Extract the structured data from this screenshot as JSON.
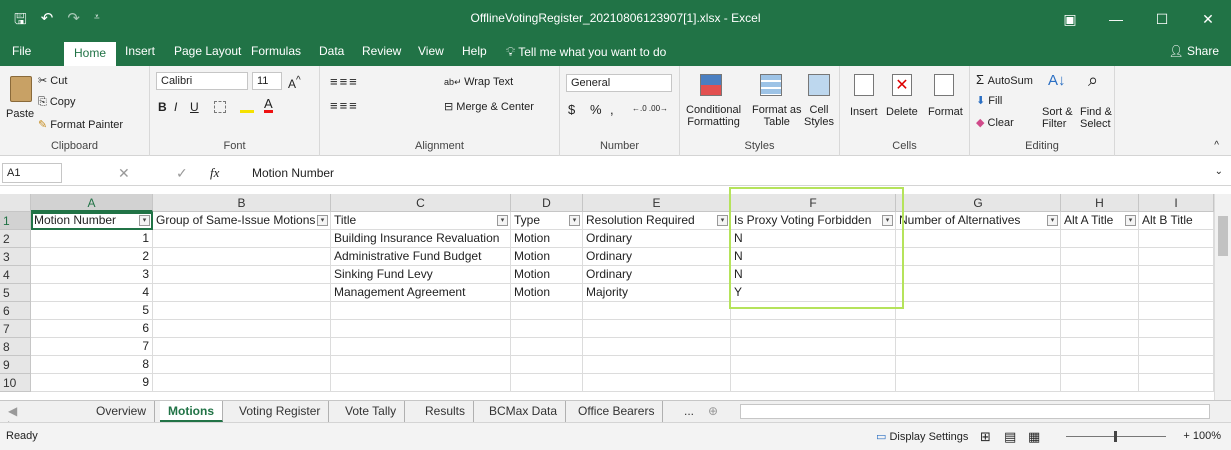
{
  "window": {
    "title": "OfflineVotingRegister_20210806123907[1].xlsx  -  Excel",
    "qat_save": "🖫",
    "qat_undo": "↶",
    "qat_redo": "↷",
    "qat_more": "⩡",
    "ribbon_display": "▣",
    "minimize": "—",
    "maximize": "☐",
    "close": "✕"
  },
  "tabs": [
    {
      "label": "File"
    },
    {
      "label": "Home"
    },
    {
      "label": "Insert"
    },
    {
      "label": "Page Layout"
    },
    {
      "label": "Formulas"
    },
    {
      "label": "Data"
    },
    {
      "label": "Review"
    },
    {
      "label": "View"
    },
    {
      "label": "Help"
    },
    {
      "label": "Tell me what you want to do"
    }
  ],
  "share_label": "Share",
  "ribbon": {
    "clipboard": {
      "label": "Clipboard",
      "paste": "Paste",
      "cut": "Cut",
      "copy": "Copy",
      "format_painter": "Format Painter"
    },
    "font": {
      "label": "Font",
      "name": "Calibri",
      "size": "11",
      "bold": "B",
      "italic": "I",
      "underline": "U"
    },
    "alignment": {
      "label": "Alignment",
      "wrap": "Wrap Text",
      "merge": "Merge & Center"
    },
    "number": {
      "label": "Number",
      "format": "General",
      "currency": "$",
      "percent": "%",
      "comma": ","
    },
    "styles": {
      "label": "Styles",
      "conditional_1": "Conditional",
      "conditional_2": "Formatting",
      "format_as_1": "Format as",
      "format_as_2": "Table",
      "cell_1": "Cell",
      "cell_2": "Styles"
    },
    "cells": {
      "label": "Cells",
      "insert": "Insert",
      "delete": "Delete",
      "format": "Format"
    },
    "editing": {
      "label": "Editing",
      "autosum": "AutoSum",
      "fill": "Fill",
      "clear": "Clear",
      "sort_1": "Sort &",
      "sort_2": "Filter",
      "find_1": "Find &",
      "find_2": "Select"
    }
  },
  "formula_bar": {
    "name_box": "A1",
    "value": "Motion Number"
  },
  "columns": [
    "A",
    "B",
    "C",
    "D",
    "E",
    "F",
    "G",
    "H",
    "I"
  ],
  "headers": [
    "Motion Number",
    "Group of Same-Issue Motions",
    "Title",
    "Type",
    "Resolution Required",
    "Is Proxy Voting Forbidden",
    "Number of Alternatives",
    "Alt A Title",
    "Alt B Title"
  ],
  "rows": [
    {
      "num": "2",
      "a": "1",
      "c": "Building Insurance Revaluation",
      "d": "Motion",
      "e": "Ordinary",
      "f": "N"
    },
    {
      "num": "3",
      "a": "2",
      "c": "Administrative Fund Budget",
      "d": "Motion",
      "e": "Ordinary",
      "f": "N"
    },
    {
      "num": "4",
      "a": "3",
      "c": "Sinking Fund Levy",
      "d": "Motion",
      "e": "Ordinary",
      "f": "N"
    },
    {
      "num": "5",
      "a": "4",
      "c": "Management Agreement",
      "d": "Motion",
      "e": "Majority",
      "f": "Y"
    },
    {
      "num": "6",
      "a": "5",
      "c": "",
      "d": "",
      "e": "",
      "f": ""
    },
    {
      "num": "7",
      "a": "6",
      "c": "",
      "d": "",
      "e": "",
      "f": ""
    },
    {
      "num": "8",
      "a": "7",
      "c": "",
      "d": "",
      "e": "",
      "f": ""
    },
    {
      "num": "9",
      "a": "8",
      "c": "",
      "d": "",
      "e": "",
      "f": ""
    },
    {
      "num": "10",
      "a": "9",
      "c": "",
      "d": "",
      "e": "",
      "f": ""
    }
  ],
  "header_row_num": "1",
  "sheets": [
    "Overview",
    "Motions",
    "Voting Register",
    "Vote Tally",
    "Results",
    "BCMax Data",
    "Office Bearers",
    "..."
  ],
  "status": {
    "ready": "Ready",
    "display_settings": "Display Settings",
    "zoom": "100%"
  },
  "colors": {
    "accent": "#217346",
    "highlight_box": "#b5e35b"
  }
}
